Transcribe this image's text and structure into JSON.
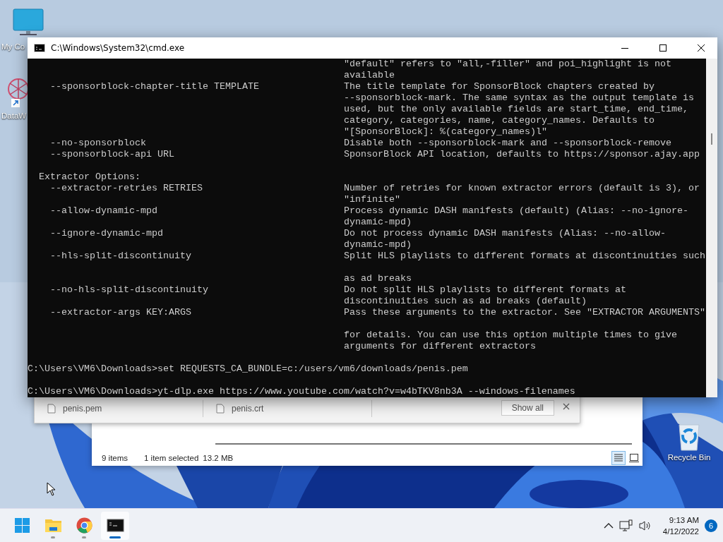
{
  "desktop_icons": [
    {
      "kind": "computer",
      "label": "My Co"
    },
    {
      "kind": "shortcut",
      "label": "DataW"
    },
    {
      "kind": "recycle",
      "label": "Recycle Bin"
    }
  ],
  "download_shelf": {
    "items": [
      "penis.pem",
      "penis.crt"
    ],
    "show_all": "Show all"
  },
  "explorer": {
    "item_count": "9 items",
    "selection": "1 item selected",
    "size": "13.2 MB",
    "views": [
      {
        "kind": "details",
        "selected": true
      },
      {
        "kind": "tiles",
        "selected": false
      }
    ]
  },
  "cmd": {
    "title": "C:\\Windows\\System32\\cmd.exe",
    "lines": [
      {
        "kind": "desc",
        "description": "\"default\" refers to \"all,-filler\" and poi_highlight is not"
      },
      {
        "kind": "desc",
        "description": "available"
      },
      {
        "kind": "option",
        "option": "--sponsorblock-chapter-title TEMPLATE",
        "description": "The title template for SponsorBlock chapters created by"
      },
      {
        "kind": "desc",
        "description": "--sponsorblock-mark. The same syntax as the output template is"
      },
      {
        "kind": "desc",
        "description": "used, but the only available fields are start_time, end_time,"
      },
      {
        "kind": "desc",
        "description": "category, categories, name, category_names. Defaults to"
      },
      {
        "kind": "desc",
        "description": "\"[SponsorBlock]: %(category_names)l\""
      },
      {
        "kind": "option",
        "option": "--no-sponsorblock",
        "description": "Disable both --sponsorblock-mark and --sponsorblock-remove"
      },
      {
        "kind": "option",
        "option": "--sponsorblock-api URL",
        "description": "SponsorBlock API location, defaults to https://sponsor.ajay.app"
      },
      {
        "kind": "blank"
      },
      {
        "kind": "heading",
        "text": "Extractor Options:"
      },
      {
        "kind": "option",
        "option": "--extractor-retries RETRIES",
        "description": "Number of retries for known extractor errors (default is 3), or"
      },
      {
        "kind": "desc",
        "description": "\"infinite\""
      },
      {
        "kind": "option",
        "option": "--allow-dynamic-mpd",
        "description": "Process dynamic DASH manifests (default) (Alias: --no-ignore-"
      },
      {
        "kind": "desc",
        "description": "dynamic-mpd)"
      },
      {
        "kind": "option",
        "option": "--ignore-dynamic-mpd",
        "description": "Do not process dynamic DASH manifests (Alias: --no-allow-"
      },
      {
        "kind": "desc",
        "description": "dynamic-mpd)"
      },
      {
        "kind": "option",
        "option": "--hls-split-discontinuity",
        "description": "Split HLS playlists to different formats at discontinuities such"
      },
      {
        "kind": "blank"
      },
      {
        "kind": "desc",
        "description": "as ad breaks"
      },
      {
        "kind": "option",
        "option": "--no-hls-split-discontinuity",
        "description": "Do not split HLS playlists to different formats at"
      },
      {
        "kind": "desc",
        "description": "discontinuities such as ad breaks (default)"
      },
      {
        "kind": "option",
        "option": "--extractor-args KEY:ARGS",
        "description": "Pass these arguments to the extractor. See \"EXTRACTOR ARGUMENTS\""
      },
      {
        "kind": "blank"
      },
      {
        "kind": "desc",
        "description": "for details. You can use this option multiple times to give"
      },
      {
        "kind": "desc",
        "description": "arguments for different extractors"
      },
      {
        "kind": "blank"
      },
      {
        "kind": "prompt",
        "text": "C:\\Users\\VM6\\Downloads>set REQUESTS_CA_BUNDLE=c:/users/vm6/downloads/penis.pem"
      },
      {
        "kind": "blank"
      },
      {
        "kind": "prompt",
        "text": "C:\\Users\\VM6\\Downloads>yt-dlp.exe https://www.youtube.com/watch?v=w4bTKV8nb3A --windows-filenames"
      }
    ]
  },
  "taskbar": {
    "apps": [
      {
        "kind": "start",
        "selected": false
      },
      {
        "kind": "explorer",
        "selected": false
      },
      {
        "kind": "chrome",
        "selected": false
      },
      {
        "kind": "terminal",
        "selected": true
      }
    ],
    "time": "9:13 AM",
    "date": "4/12/2022",
    "notifications": "6"
  }
}
